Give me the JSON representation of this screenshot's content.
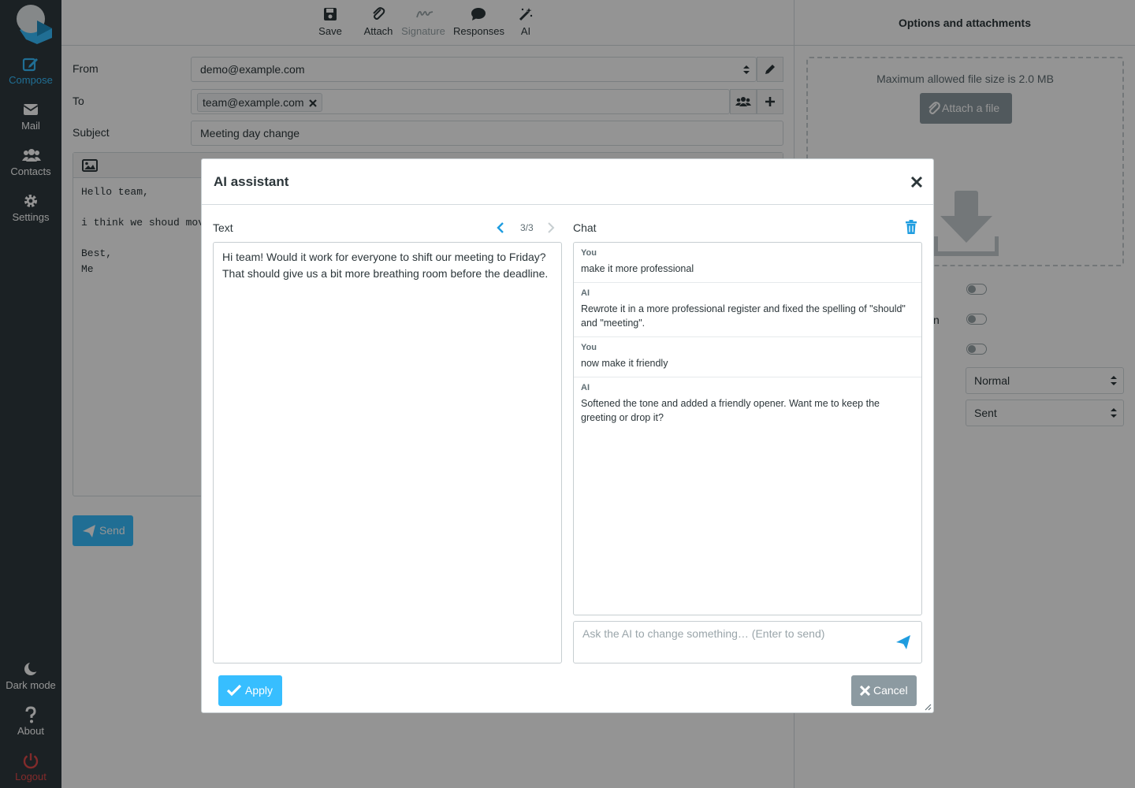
{
  "sidebar": {
    "items": [
      {
        "label": "Compose",
        "icon": "compose-icon"
      },
      {
        "label": "Mail",
        "icon": "mail-icon"
      },
      {
        "label": "Contacts",
        "icon": "contacts-icon"
      },
      {
        "label": "Settings",
        "icon": "gear-icon"
      }
    ],
    "bottom": [
      {
        "label": "Dark mode",
        "icon": "moon-icon"
      },
      {
        "label": "About",
        "icon": "question-icon"
      },
      {
        "label": "Logout",
        "icon": "power-icon"
      }
    ]
  },
  "toolbar": {
    "save": "Save",
    "attach": "Attach",
    "signature": "Signature",
    "responses": "Responses",
    "ai": "AI"
  },
  "compose": {
    "from_label": "From",
    "from_value": "demo@example.com",
    "to_label": "To",
    "to_recipient": "team@example.com",
    "subject_label": "Subject",
    "subject_value": "Meeting day change",
    "body": "Hello team,\n\ni think we shoud mov\n\nBest,\nMe",
    "send": "Send"
  },
  "options": {
    "title": "Options and attachments",
    "max_size": "Maximum allowed file size is 2.0 MB",
    "attach_button": "Attach a file",
    "priority": "Normal",
    "save_folder": "Sent",
    "partial_label_char": "n"
  },
  "dialog": {
    "title": "AI assistant",
    "text_label": "Text",
    "pager": "3/3",
    "chat_label": "Chat",
    "text_value": "Hi team! Would it work for everyone to shift our meeting to Friday? That should give us a bit more breathing room before the deadline.",
    "messages": [
      {
        "role": "You",
        "text": "make it more professional"
      },
      {
        "role": "AI",
        "text": "Rewrote it in a more professional register and fixed the spelling of \"should\" and \"meeting\"."
      },
      {
        "role": "You",
        "text": "now make it friendly"
      },
      {
        "role": "AI",
        "text": "Softened the tone and added a friendly opener. Want me to keep the greeting or drop it?"
      }
    ],
    "chat_placeholder": "Ask the AI to change something… (Enter to send)",
    "apply": "Apply",
    "cancel": "Cancel"
  },
  "colors": {
    "accent": "#37beff",
    "sidebar": "#2f3a3f",
    "secondary_button": "#8c9aa1",
    "danger": "#e14a4a"
  }
}
